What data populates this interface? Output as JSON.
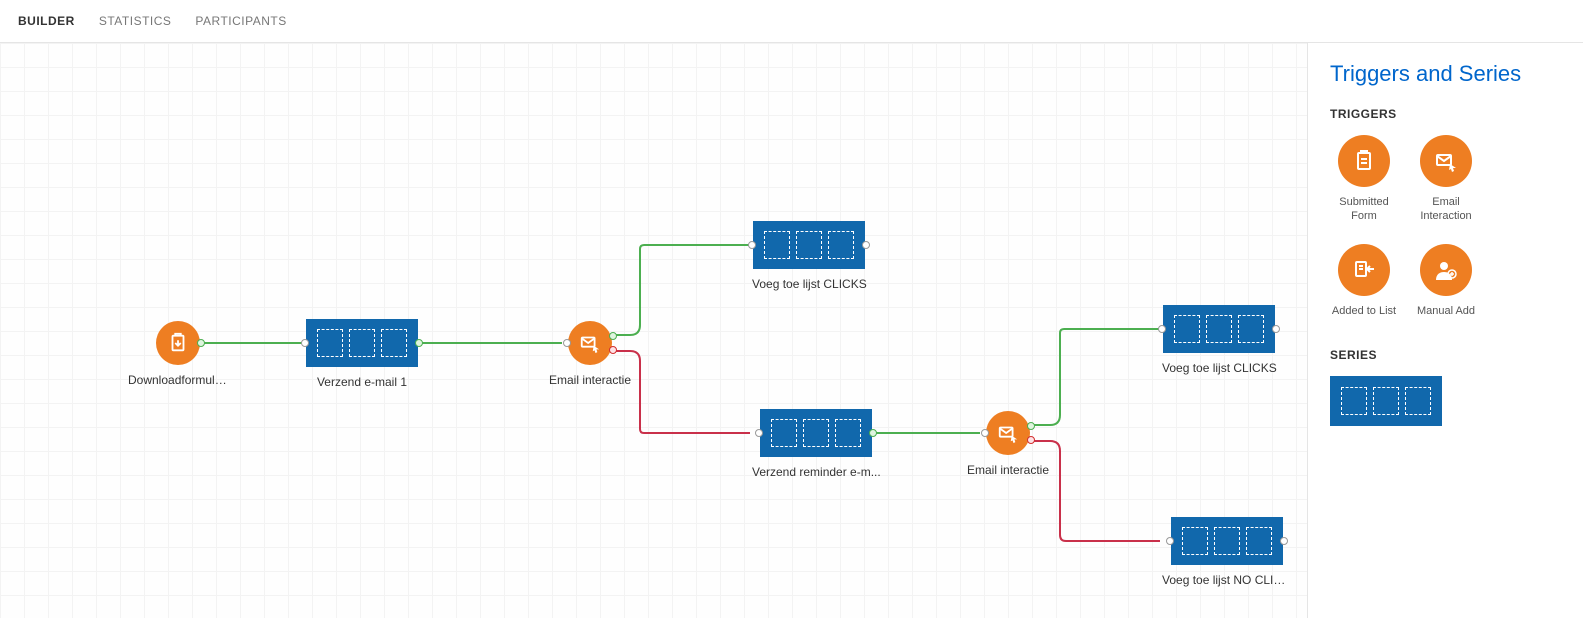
{
  "tabs": {
    "builder": "BUILDER",
    "statistics": "STATISTICS",
    "participants": "PARTICIPANTS"
  },
  "sidebar": {
    "title": "Triggers and Series",
    "triggers_heading": "TRIGGERS",
    "series_heading": "SERIES",
    "triggers": {
      "submitted_form": "Submitted Form",
      "email_interaction": "Email Interaction",
      "added_to_list": "Added to List",
      "manual_add": "Manual Add"
    }
  },
  "nodes": {
    "download_form": "Downloadformulier",
    "send_email_1": "Verzend e-mail 1",
    "email_interaction_1": "Email interactie",
    "add_list_clicks_1": "Voeg toe lijst CLICKS",
    "send_reminder": "Verzend reminder e-m...",
    "email_interaction_2": "Email interactie",
    "add_list_clicks_2": "Voeg toe lijst CLICKS",
    "add_list_no_clicks": "Voeg toe lijst NO CLIC..."
  },
  "colors": {
    "accent_orange": "#ee7e22",
    "series_blue": "#1168ac",
    "link_blue": "#0066cc",
    "connector_green": "#4caf50",
    "connector_red": "#c9304a"
  }
}
